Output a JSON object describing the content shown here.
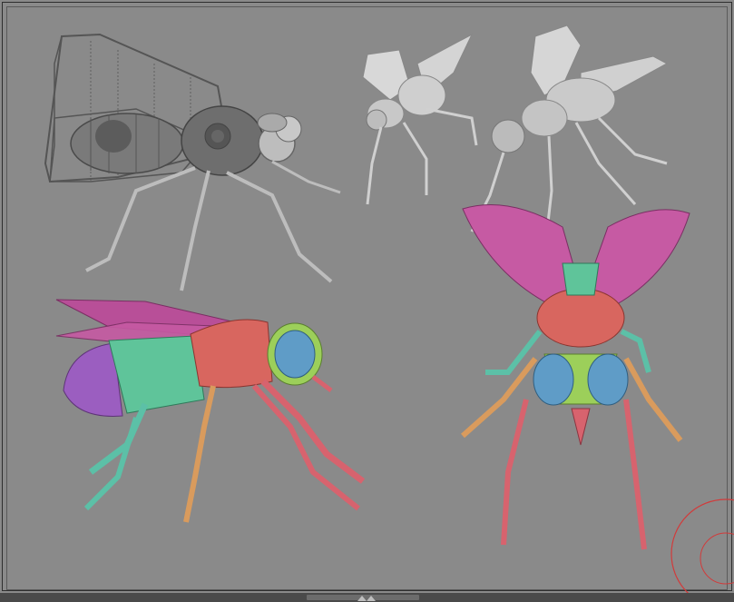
{
  "scene": {
    "background_color": "#8a8a8a",
    "models": [
      {
        "id": "fly-wireframe-side",
        "style": "grey-shaded"
      },
      {
        "id": "fly-grey-small",
        "style": "grey-shaded"
      },
      {
        "id": "fly-grey-large",
        "style": "grey-shaded"
      },
      {
        "id": "fly-colored-side",
        "style": "polygroup-colors"
      },
      {
        "id": "fly-colored-front",
        "style": "polygroup-colors"
      }
    ],
    "polygroup_colors": {
      "wing": "#c65aa3",
      "abdomen_tip": "#9b5ec0",
      "abdomen": "#5fc49a",
      "thorax": "#d8665f",
      "eye": "#5f9cc7",
      "head_ring": "#9ccf5a",
      "front_leg": "#d7636e",
      "mid_leg": "#d99b5d",
      "hind_leg": "#5cc0a7"
    },
    "gizmo_color": "#d23a3a"
  },
  "footer": {
    "grip_icon": "triangle-up-icon"
  }
}
